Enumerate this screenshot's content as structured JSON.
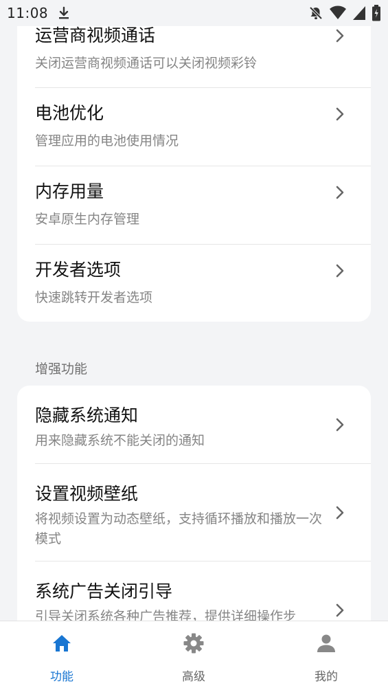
{
  "status_bar": {
    "time": "11:08",
    "icons": [
      "download-icon",
      "notifications-off-icon",
      "wifi-icon",
      "cell-signal-icon",
      "battery-icon"
    ]
  },
  "card1": {
    "items": [
      {
        "title": "运营商视频通话",
        "subtitle": "关闭运营商视频通话可以关闭视频彩铃"
      },
      {
        "title": "电池优化",
        "subtitle": "管理应用的电池使用情况"
      },
      {
        "title": "内存用量",
        "subtitle": "安卓原生内存管理"
      },
      {
        "title": "开发者选项",
        "subtitle": "快速跳转开发者选项"
      }
    ]
  },
  "section": {
    "title": "增强功能"
  },
  "card2": {
    "items": [
      {
        "title": "隐藏系统通知",
        "subtitle": "用来隐藏系统不能关闭的通知"
      },
      {
        "title": "设置视频壁纸",
        "subtitle": "将视频设置为动态壁纸，支持循环播放和播放一次模式"
      },
      {
        "title": "系统广告关闭引导",
        "subtitle": "引导关闭系统各种广告推荐，提供详细操作步"
      }
    ]
  },
  "bottom_nav": {
    "items": [
      {
        "label": "功能",
        "icon": "home-icon",
        "active": true
      },
      {
        "label": "高级",
        "icon": "gear-icon",
        "active": false
      },
      {
        "label": "我的",
        "icon": "person-icon",
        "active": false
      }
    ]
  },
  "colors": {
    "accent": "#1976d2",
    "background": "#f3f4f6",
    "card": "#ffffff",
    "subtitle": "#858585",
    "nav_inactive": "#888888"
  }
}
